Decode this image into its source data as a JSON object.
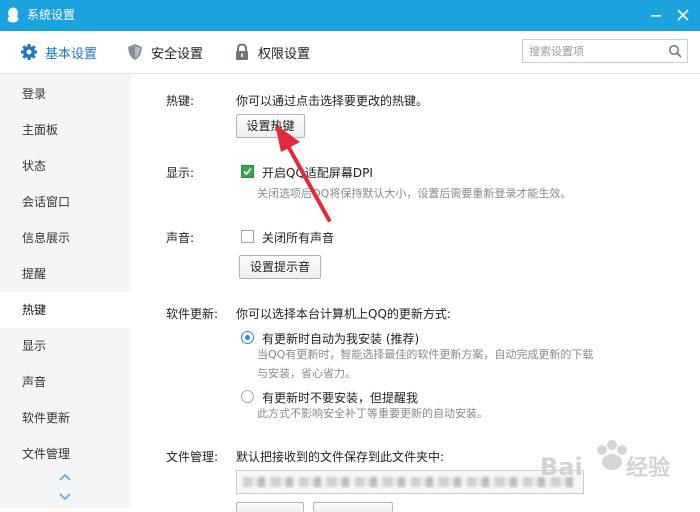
{
  "window": {
    "title": "系统设置"
  },
  "toolbar": {
    "tabs": [
      {
        "label": "基本设置",
        "icon": "gear-icon"
      },
      {
        "label": "安全设置",
        "icon": "shield-icon"
      },
      {
        "label": "权限设置",
        "icon": "lock-icon"
      }
    ],
    "active_tab": "基本设置",
    "search_placeholder": "搜索设置项"
  },
  "sidebar": {
    "items": [
      "登录",
      "主面板",
      "状态",
      "会话窗口",
      "信息展示",
      "提醒",
      "热键",
      "显示",
      "声音",
      "软件更新",
      "文件管理"
    ],
    "active": "热键"
  },
  "hotkey": {
    "label": "热键:",
    "desc": "你可以通过点击选择要更改的热键。",
    "button": "设置热键"
  },
  "display": {
    "label": "显示:",
    "checkbox_label": "开启QQ适配屏幕DPI",
    "checked": true,
    "hint": "关闭选项后QQ将保持默认大小，设置后需要重新登录才能生效。"
  },
  "sound": {
    "label": "声音:",
    "checkbox_label": "关闭所有声音",
    "checked": false,
    "button": "设置提示音"
  },
  "update": {
    "label": "软件更新:",
    "desc": "你可以选择本台计算机上QQ的更新方式:",
    "options": [
      {
        "label": "有更新时自动为我安装 (推荐)",
        "selected": true,
        "hint": [
          "当QQ有更新时，智能选择最佳的软件更新方案，自动完成更新的下载",
          "与安装，省心省力。"
        ]
      },
      {
        "label": "有更新时不要安装，但提醒我",
        "selected": false,
        "hint": [
          "此方式不影响安全补丁等重要更新的自动安装。"
        ]
      }
    ]
  },
  "files": {
    "label": "文件管理:",
    "desc": "默认把接收到的文件保存到此文件夹中:"
  },
  "watermark": "Baidu经验",
  "colors": {
    "titlebar": "#1aa3dc",
    "accent": "#1a78c6",
    "check": "#3aa54c",
    "arrow": "#e5283a"
  }
}
